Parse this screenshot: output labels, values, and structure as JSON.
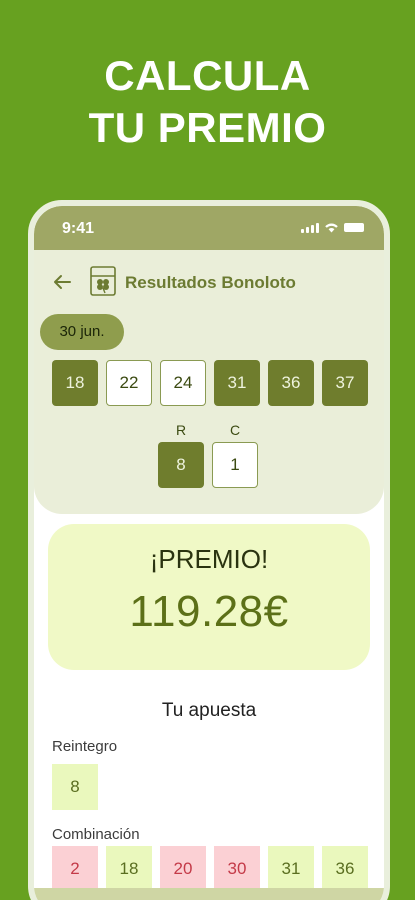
{
  "headline": {
    "line1": "CALCULA",
    "line2": "TU PREMIO"
  },
  "status_bar": {
    "time": "9:41"
  },
  "app_bar": {
    "title": "Resultados Bonoloto"
  },
  "draw": {
    "date": "30 jun.",
    "numbers": [
      {
        "value": "18",
        "style": "dark"
      },
      {
        "value": "22",
        "style": "light"
      },
      {
        "value": "24",
        "style": "light"
      },
      {
        "value": "31",
        "style": "dark"
      },
      {
        "value": "36",
        "style": "dark"
      },
      {
        "value": "37",
        "style": "dark"
      }
    ],
    "reintegro_label": "R",
    "complementario_label": "C",
    "reintegro": "8",
    "complementario": "1"
  },
  "prize": {
    "label": "¡PREMIO!",
    "amount": "119.28€"
  },
  "bet": {
    "title": "Tu apuesta",
    "reintegro_label": "Reintegro",
    "reintegro": "8",
    "combinacion_label": "Combinación",
    "numbers": [
      {
        "value": "2",
        "hit": false
      },
      {
        "value": "18",
        "hit": true
      },
      {
        "value": "20",
        "hit": false
      },
      {
        "value": "30",
        "hit": false
      },
      {
        "value": "31",
        "hit": true
      },
      {
        "value": "36",
        "hit": true
      }
    ]
  },
  "colors": {
    "background": "#67a120",
    "accent": "#6f7d2d",
    "prize_card": "#f0f9c6",
    "miss": "#fbd0d4",
    "hit": "#eaf8bd"
  }
}
